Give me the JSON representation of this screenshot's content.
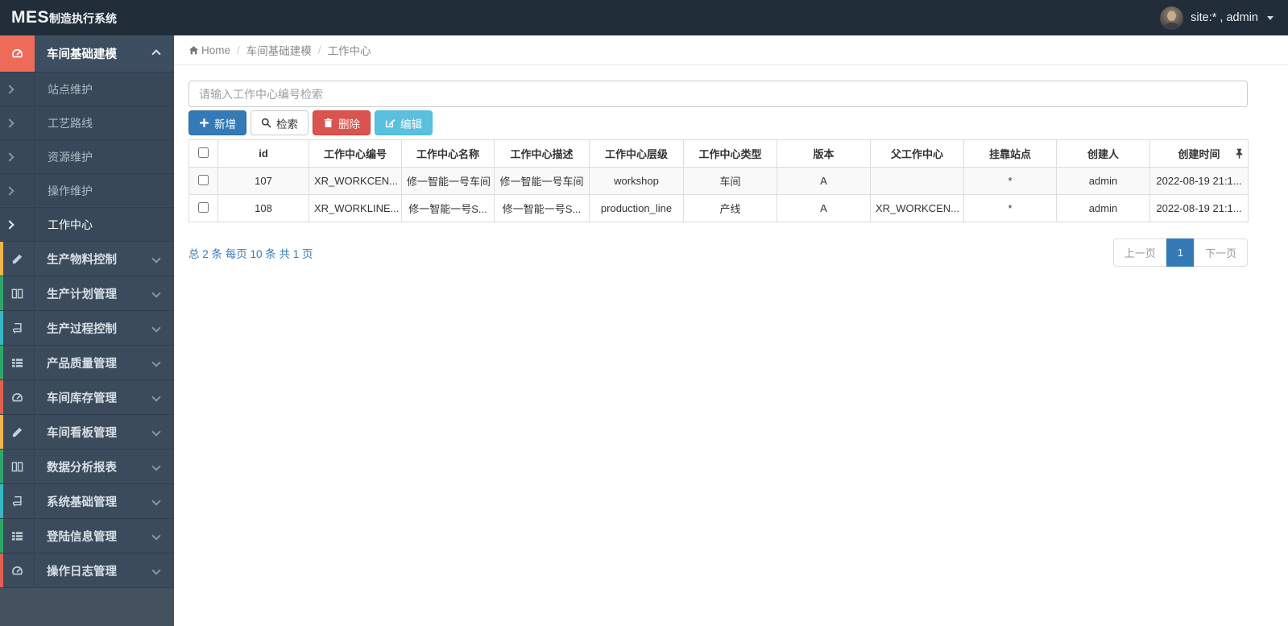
{
  "topbar": {
    "logo_mes": "MES",
    "logo_suffix": "制造执行系统",
    "user_label": "site:* , admin"
  },
  "breadcrumb": {
    "home_label": "Home",
    "level1": "车间基础建模",
    "level2": "工作中心"
  },
  "sidebar": {
    "active_group": {
      "label": "车间基础建模"
    },
    "submenu": [
      {
        "label": "站点维护"
      },
      {
        "label": "工艺路线"
      },
      {
        "label": "资源维护"
      },
      {
        "label": "操作维护"
      },
      {
        "label": "工作中心"
      }
    ],
    "groups": [
      {
        "label": "生产物料控制"
      },
      {
        "label": "生产计划管理"
      },
      {
        "label": "生产过程控制"
      },
      {
        "label": "产品质量管理"
      },
      {
        "label": "车间库存管理"
      },
      {
        "label": "车间看板管理"
      },
      {
        "label": "数据分析报表"
      },
      {
        "label": "系统基础管理"
      },
      {
        "label": "登陆信息管理"
      },
      {
        "label": "操作日志管理"
      }
    ]
  },
  "toolbar": {
    "search_placeholder": "请输入工作中心编号检索",
    "add_label": "新增",
    "search_label": "检索",
    "delete_label": "删除",
    "edit_label": "编辑"
  },
  "table": {
    "columns": [
      "id",
      "工作中心编号",
      "工作中心名称",
      "工作中心描述",
      "工作中心层级",
      "工作中心类型",
      "版本",
      "父工作中心",
      "挂靠站点",
      "创建人",
      "创建时间"
    ],
    "rows": [
      {
        "id": "107",
        "code": "XR_WORKCEN...",
        "name": "修一智能一号车间",
        "desc": "修一智能一号车间",
        "level": "workshop",
        "type": "车间",
        "version": "A",
        "parent": "",
        "station": "*",
        "creator": "admin",
        "created": "2022-08-19 21:1..."
      },
      {
        "id": "108",
        "code": "XR_WORKLINE...",
        "name": "修一智能一号S...",
        "desc": "修一智能一号S...",
        "level": "production_line",
        "type": "产线",
        "version": "A",
        "parent": "XR_WORKCEN...",
        "station": "*",
        "creator": "admin",
        "created": "2022-08-19 21:1..."
      }
    ]
  },
  "pagination": {
    "summary": "总 2 条  每页 10 条  共 1 页",
    "prev_label": "上一页",
    "page_label": "1",
    "next_label": "下一页"
  },
  "colors": {
    "topbar_bg": "#222d3a",
    "sidebar_bg": "#3c4b5c",
    "active_icon_bg": "#ee6b59",
    "stripe_red": "#e15f50",
    "stripe_yellow": "#efb34c",
    "stripe_green": "#2fa66a",
    "stripe_aqua": "#38b8c4",
    "primary": "#337ab7",
    "danger": "#d9534f",
    "info": "#5bc0de"
  }
}
